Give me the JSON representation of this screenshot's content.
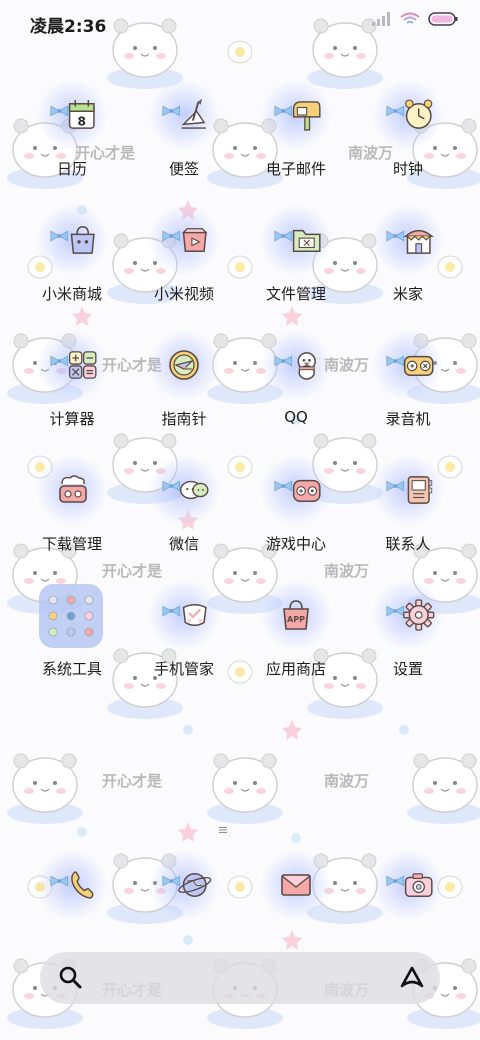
{
  "status_bar": {
    "time": "凌晨2:36"
  },
  "wallpaper": {
    "text_left": "开心才是",
    "text_right": "南波万"
  },
  "apps": [
    {
      "label": "日历",
      "icon": "calendar-icon",
      "date": "8"
    },
    {
      "label": "便签",
      "icon": "notes-icon"
    },
    {
      "label": "电子邮件",
      "icon": "mailbox-icon"
    },
    {
      "label": "时钟",
      "icon": "clock-icon"
    },
    {
      "label": "小米商城",
      "icon": "shopping-bag-icon"
    },
    {
      "label": "小米视频",
      "icon": "video-icon"
    },
    {
      "label": "文件管理",
      "icon": "folder-icon"
    },
    {
      "label": "米家",
      "icon": "house-icon"
    },
    {
      "label": "计算器",
      "icon": "calculator-icon"
    },
    {
      "label": "指南针",
      "icon": "compass-icon"
    },
    {
      "label": "QQ",
      "icon": "qq-penguin-icon"
    },
    {
      "label": "录音机",
      "icon": "recorder-icon"
    },
    {
      "label": "下载管理",
      "icon": "download-icon"
    },
    {
      "label": "微信",
      "icon": "wechat-icon"
    },
    {
      "label": "游戏中心",
      "icon": "gamepad-icon"
    },
    {
      "label": "联系人",
      "icon": "contacts-book-icon"
    },
    {
      "label": "系统工具",
      "icon": "folder-grid-icon"
    },
    {
      "label": "手机管家",
      "icon": "security-icon"
    },
    {
      "label": "应用商店",
      "icon": "app-store-bag-icon",
      "badge": "APP"
    },
    {
      "label": "设置",
      "icon": "gear-icon"
    }
  ],
  "dock": [
    {
      "icon": "phone-icon"
    },
    {
      "icon": "browser-globe-icon"
    },
    {
      "icon": "messages-envelope-icon"
    },
    {
      "icon": "camera-icon"
    }
  ],
  "colors": {
    "glow": "#aab8ff",
    "bow": "#9cc8f0",
    "outline": "#5a4a44"
  }
}
